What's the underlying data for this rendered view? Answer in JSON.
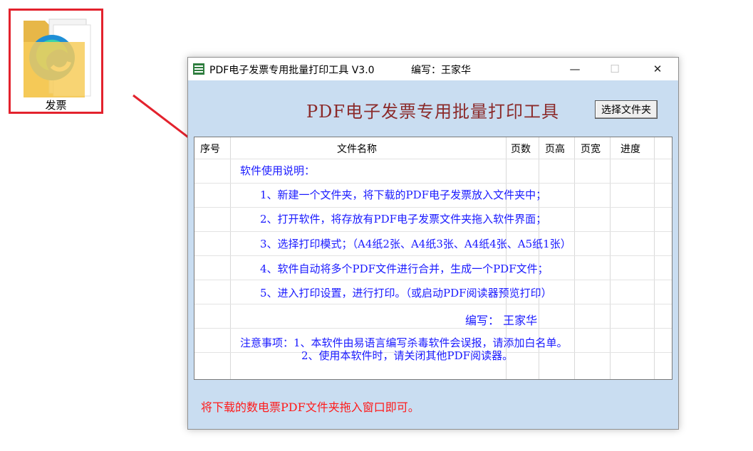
{
  "desktop": {
    "folder_label": "发票"
  },
  "window": {
    "title": "PDF电子发票专用批量打印工具 V3.0",
    "author": "编写：王家华",
    "controls": {
      "minimize": "—",
      "maximize": "☐",
      "close": "✕"
    }
  },
  "app": {
    "heading": "PDF电子发票专用批量打印工具",
    "choose_folder_label": "选择文件夹"
  },
  "table": {
    "columns": [
      "序号",
      "文件名称",
      "页数",
      "页高",
      "页宽",
      "进度"
    ]
  },
  "instructions": {
    "title": "软件使用说明：",
    "steps": [
      "1、新建一个文件夹，将下载的PDF电子发票放入文件夹中；",
      "2、打开软件，将存放有PDF电子发票文件夹拖入软件界面；",
      "3、选择打印模式；（A4纸2张、A4纸3张、A4纸4张、A5纸1张）",
      "4、软件自动将多个PDF文件进行合并，生成一个PDF文件；",
      "5、进入打印设置，进行打印。（或启动PDF阅读器预览打印）"
    ],
    "author": "编写： 王家华",
    "notes_line1": "注意事项：1、本软件由易语言编写杀毒软件会误报，请添加白名单。",
    "notes_line2": "2、使用本软件时，请关闭其他PDF阅读器。"
  },
  "status": "将下载的数电票PDF文件夹拖入窗口即可。",
  "colors": {
    "highlight_red": "#e3222d",
    "instruction_blue": "#1a1aff",
    "heading_maroon": "#8b2a2a",
    "window_bg": "#c9ddf1"
  }
}
